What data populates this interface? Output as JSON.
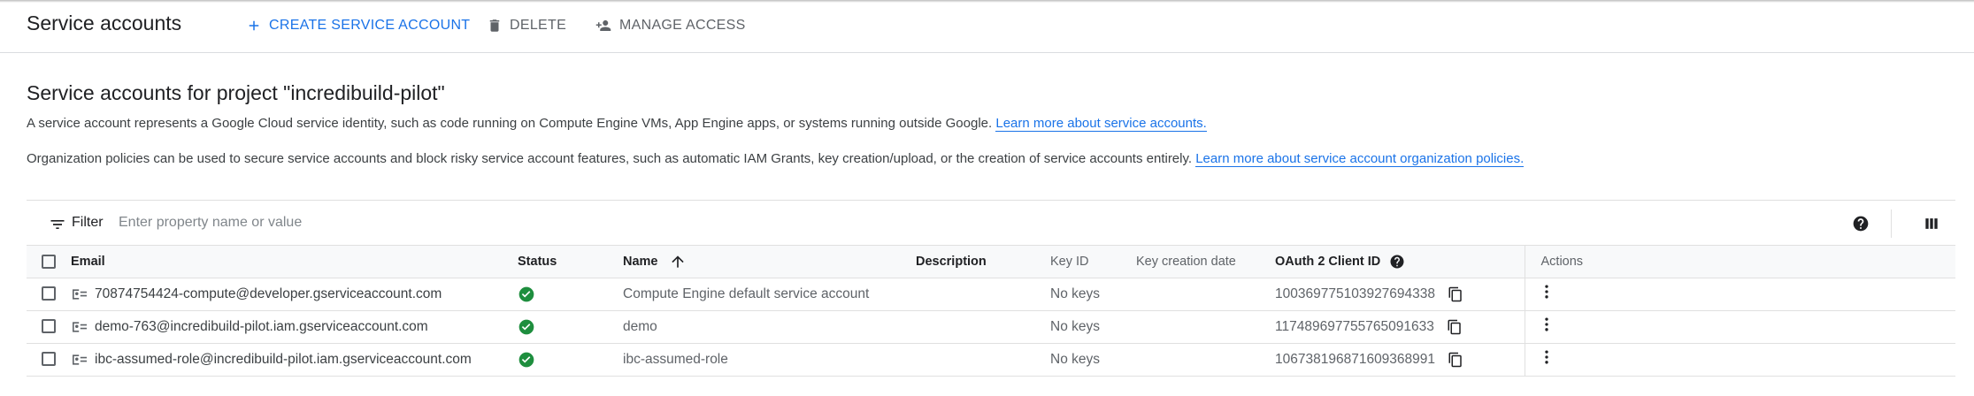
{
  "header": {
    "title": "Service accounts",
    "create_label": "CREATE SERVICE ACCOUNT",
    "delete_label": "DELETE",
    "manage_label": "MANAGE ACCESS"
  },
  "section": {
    "title": "Service accounts for project \"incredibuild-pilot\"",
    "desc1_text": "A service account represents a Google Cloud service identity, such as code running on Compute Engine VMs, App Engine apps, or systems running outside Google.",
    "desc1_link": "Learn more about service accounts.",
    "desc2_text": "Organization policies can be used to secure service accounts and block risky service account features, such as automatic IAM Grants, key creation/upload, or the creation of service accounts entirely.",
    "desc2_link": "Learn more about service account organization policies."
  },
  "filter": {
    "label": "Filter",
    "placeholder": "Enter property name or value"
  },
  "table": {
    "headers": {
      "email": "Email",
      "status": "Status",
      "name": "Name",
      "description": "Description",
      "key_id": "Key ID",
      "key_creation_date": "Key creation date",
      "oauth_client_id": "OAuth 2 Client ID",
      "actions": "Actions"
    },
    "rows": [
      {
        "email": "70874754424-compute@developer.gserviceaccount.com",
        "name": "Compute Engine default service account",
        "description": "",
        "key_id": "No keys",
        "key_creation_date": "",
        "client_id": "100369775103927694338"
      },
      {
        "email": "demo-763@incredibuild-pilot.iam.gserviceaccount.com",
        "name": "demo",
        "description": "",
        "key_id": "No keys",
        "key_creation_date": "",
        "client_id": "117489697755765091633"
      },
      {
        "email": "ibc-assumed-role@incredibuild-pilot.iam.gserviceaccount.com",
        "name": "ibc-assumed-role",
        "description": "",
        "key_id": "No keys",
        "key_creation_date": "",
        "client_id": "106738196871609368991"
      }
    ]
  },
  "colors": {
    "accent": "#1a73e8",
    "status_ok": "#1e8e3e",
    "text_primary": "#202124",
    "text_secondary": "#5f6368",
    "divider": "#e0e0e0"
  },
  "icons": {
    "create": "plus-icon",
    "delete": "trash-icon",
    "manage": "person-add-icon",
    "filter": "filter-icon",
    "help": "help-icon",
    "columns": "column-display-icon",
    "row_account": "service-account-icon",
    "status": "check-circle-icon",
    "copy": "copy-icon",
    "actions": "more-vert-icon",
    "sort": "arrow-up-icon"
  }
}
